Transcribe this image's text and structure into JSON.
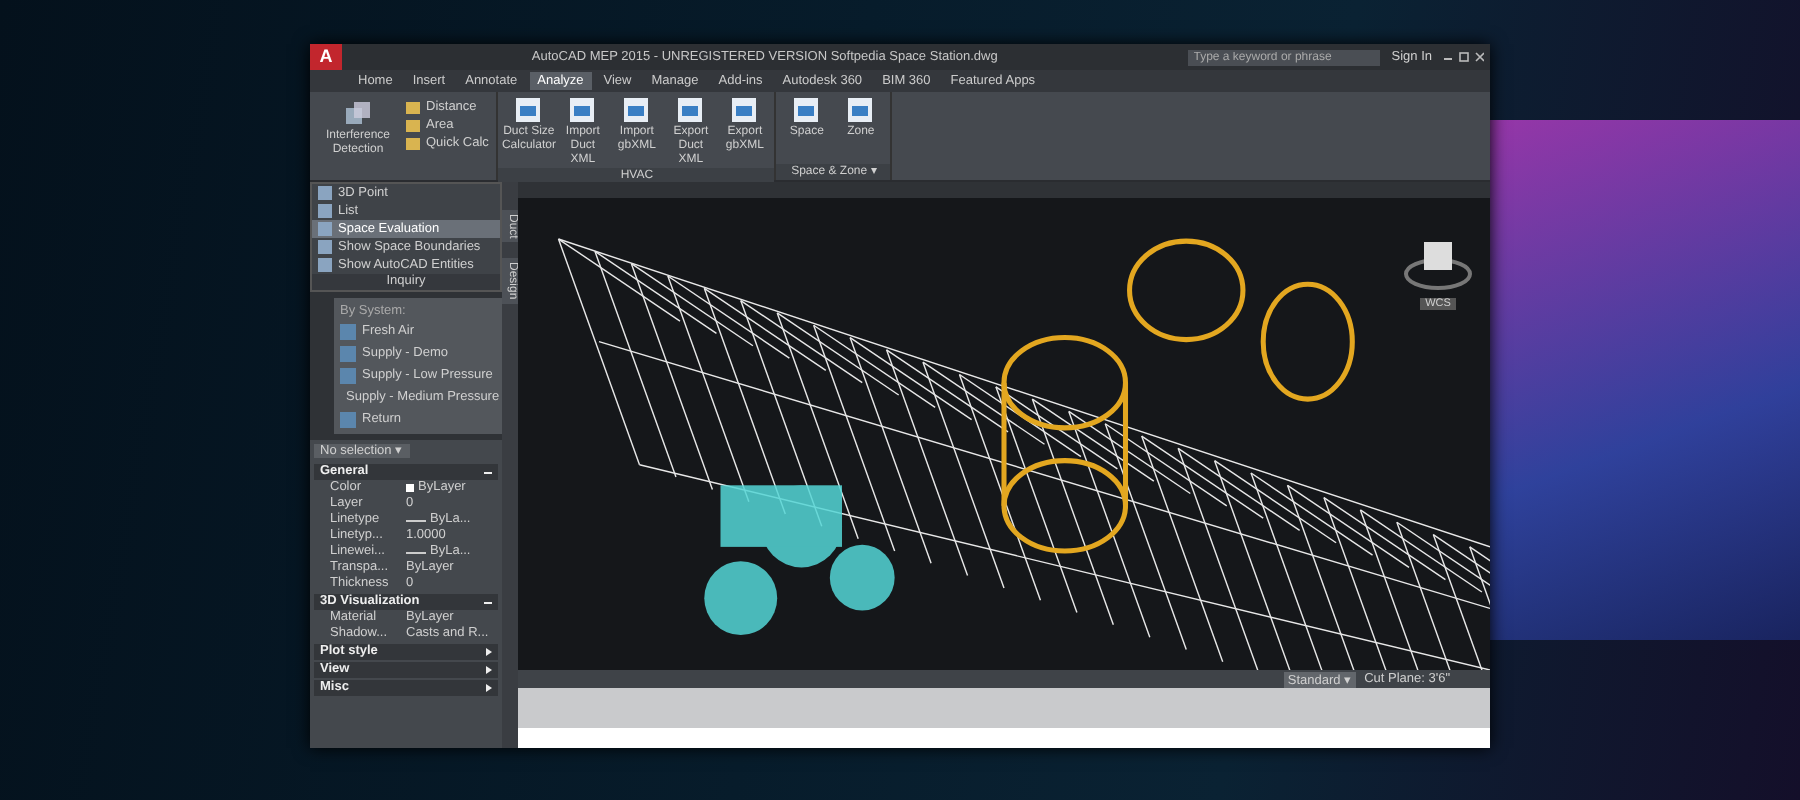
{
  "window": {
    "title": "AutoCAD MEP 2015 - UNREGISTERED VERSION    Softpedia Space Station.dwg"
  },
  "logo": "A",
  "search": {
    "placeholder": "Type a keyword or phrase"
  },
  "sign_in": "Sign In",
  "ribbon_tabs": [
    {
      "label": "Home",
      "selected": false
    },
    {
      "label": "Insert",
      "selected": false
    },
    {
      "label": "Annotate",
      "selected": false
    },
    {
      "label": "Analyze",
      "selected": true
    },
    {
      "label": "View",
      "selected": false
    },
    {
      "label": "Manage",
      "selected": false
    },
    {
      "label": "Add-ins",
      "selected": false
    },
    {
      "label": "Autodesk 360",
      "selected": false
    },
    {
      "label": "BIM 360",
      "selected": false
    },
    {
      "label": "Featured Apps",
      "selected": false
    }
  ],
  "inquiry_tools": {
    "large": "Interference Detection",
    "small": [
      "Distance",
      "Area",
      "Quick Calc"
    ]
  },
  "panels": [
    {
      "label": "HVAC",
      "tools": [
        "Duct Size Calculator",
        "Import Duct XML",
        "Import gbXML",
        "Export Duct XML",
        "Export gbXML"
      ]
    },
    {
      "label": "Space & Zone ▾",
      "tools": [
        "Space",
        "Zone"
      ]
    }
  ],
  "inquiry_menu": {
    "title": "Inquiry",
    "items": [
      {
        "label": "3D Point",
        "selected": false
      },
      {
        "label": "List",
        "selected": false
      },
      {
        "label": "Space Evaluation",
        "selected": true
      },
      {
        "label": "Show Space Boundaries",
        "selected": false
      },
      {
        "label": "Show AutoCAD Entities",
        "selected": false
      }
    ]
  },
  "systems_palette": {
    "heading": "By System:",
    "items": [
      "Fresh Air",
      "Supply - Demo",
      "Supply - Low Pressure",
      "Supply - Medium Pressure",
      "Return"
    ]
  },
  "palette_tabs": [
    "Duct",
    "Design"
  ],
  "properties": {
    "selection": "No selection ▾",
    "sections": [
      {
        "title": "General",
        "expanded": true,
        "rows": [
          {
            "name": "Color",
            "value": "ByLayer",
            "kind": "color"
          },
          {
            "name": "Layer",
            "value": "0",
            "kind": "text"
          },
          {
            "name": "Linetype",
            "value": "ByLa...",
            "kind": "line"
          },
          {
            "name": "Linetyp...",
            "value": "1.0000",
            "kind": "text"
          },
          {
            "name": "Linewei...",
            "value": "ByLa...",
            "kind": "line"
          },
          {
            "name": "Transpa...",
            "value": "ByLayer",
            "kind": "text"
          },
          {
            "name": "Thickness",
            "value": "0",
            "kind": "text"
          }
        ]
      },
      {
        "title": "3D Visualization",
        "expanded": true,
        "rows": [
          {
            "name": "Material",
            "value": "ByLayer",
            "kind": "text"
          },
          {
            "name": "Shadow...",
            "value": "Casts and R...",
            "kind": "text"
          }
        ]
      },
      {
        "title": "Plot style",
        "expanded": false
      },
      {
        "title": "View",
        "expanded": false
      },
      {
        "title": "Misc",
        "expanded": false
      }
    ]
  },
  "viewcube": {
    "label": "WCS"
  },
  "status_bar": {
    "style": "Standard ▾",
    "cut_plane": "Cut Plane: 3'6\""
  }
}
